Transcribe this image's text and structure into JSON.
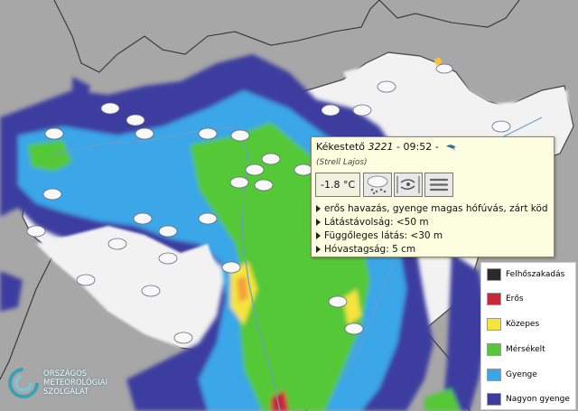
{
  "station": {
    "name": "Kékestető",
    "number": "3221",
    "time": "09:52",
    "separator": "-",
    "observer": "(Strell Lajos)",
    "temperature": "-1.8 °C",
    "weather_icon": "heavy-snow-icon",
    "wind_icon": "wind-direction-arrow-icon",
    "lines": [
      "erős havazás, gyenge magas hófúvás, zárt köd",
      "Látástávolság: <50 m",
      "Függőleges látás: <30 m",
      "Hóvastagság: 5 cm"
    ]
  },
  "legend": {
    "items": [
      {
        "label": "Felhőszakadás",
        "color": "#2a2a2a"
      },
      {
        "label": "Erős",
        "color": "#c8283a"
      },
      {
        "label": "Közepes",
        "color": "#f4e43c"
      },
      {
        "label": "Mérsékelt",
        "color": "#55c838"
      },
      {
        "label": "Gyenge",
        "color": "#3aa6e8"
      },
      {
        "label": "Nagyon gyenge",
        "color": "#3c3ca0"
      }
    ]
  },
  "logo": {
    "line1": "ORSZÁGOS",
    "line2": "METEOROLÓGIAI",
    "line3": "SZOLGÁLAT"
  }
}
